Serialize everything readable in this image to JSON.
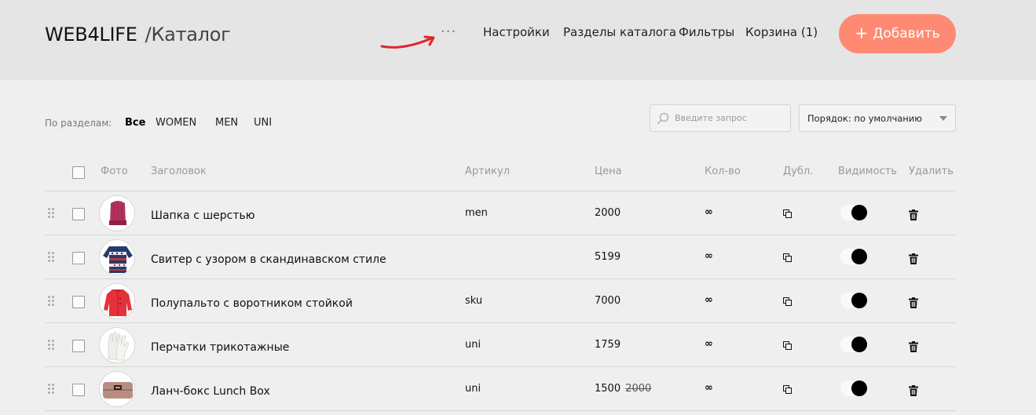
{
  "header": {
    "brand": "WEB4LIFE",
    "section": "/Каталог",
    "more_icon": "more-dots-icon",
    "nav": [
      "Настройки",
      "Разделы каталога",
      "Фильтры",
      "Корзина (1)"
    ],
    "add_button": {
      "icon": "+",
      "label": "Добавить"
    },
    "colors": {
      "header_bg": "#e5e5e5",
      "accent": "#ff8a73",
      "annotation_arrow": "#e0242b"
    }
  },
  "filters": {
    "label": "По разделам:",
    "items": [
      "Все",
      "WOMEN",
      "MEN",
      "UNI"
    ],
    "active": "Все"
  },
  "search": {
    "placeholder": "Введите запрос",
    "value": ""
  },
  "sort": {
    "label": "Порядок: по умолчанию"
  },
  "table": {
    "columns": [
      "Фото",
      "Заголовок",
      "Артикул",
      "Цена",
      "Кол-во",
      "Дубл.",
      "Видимость",
      "Удалить"
    ],
    "rows": [
      {
        "photo": "knit-hat",
        "title": "Шапка с шерстью",
        "sku": "men",
        "price": "2000",
        "old_price": "",
        "qty": "∞",
        "visible": true
      },
      {
        "photo": "patterned-sweater",
        "title": "Свитер с узором в скандинавском стиле",
        "sku": "",
        "price": "5199",
        "old_price": "",
        "qty": "∞",
        "visible": true
      },
      {
        "photo": "red-coat",
        "title": "Полупальто с воротником стойкой",
        "sku": "sku",
        "price": "7000",
        "old_price": "",
        "qty": "∞",
        "visible": true
      },
      {
        "photo": "white-gloves",
        "title": "Перчатки трикотажные",
        "sku": "uni",
        "price": "1759",
        "old_price": "",
        "qty": "∞",
        "visible": true
      },
      {
        "photo": "lunch-box",
        "title": "Ланч-бокс Lunch Box",
        "sku": "uni",
        "price": "1500",
        "old_price": "2000",
        "qty": "∞",
        "visible": true
      }
    ]
  }
}
